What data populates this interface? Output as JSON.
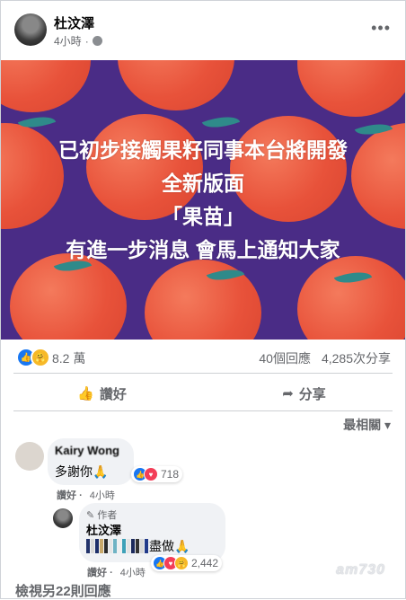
{
  "post": {
    "author": "杜汶澤",
    "time": "4小時",
    "more_icon": "more-icon",
    "privacy_icon": "globe-icon"
  },
  "image": {
    "lines": [
      "已初步接觸果籽同事本台將開發",
      "全新版面",
      "「果苗」",
      "有進一步消息 會馬上通知大家"
    ],
    "colors": {
      "background": "#4a2c86",
      "fruit": "#e8523a",
      "leaf": "#2f8a8a"
    }
  },
  "stats": {
    "reaction_count": "8.2 萬",
    "comments": "40個回應",
    "shares": "4,285次分享"
  },
  "actions": {
    "like": "讚好",
    "share": "分享"
  },
  "sort_label": "最相關",
  "comments": [
    {
      "author": "Kairy Wong",
      "text": "多謝你🙏",
      "reaction_count": "718",
      "like": "讚好",
      "time": "4小時"
    },
    {
      "author_badge": "作者",
      "author": "杜汶澤",
      "text_suffix": "盡做🙏",
      "reaction_count": "2,442",
      "like": "讚好",
      "time": "4小時"
    }
  ],
  "view_more": "檢視另22則回應",
  "watermark": "am730",
  "colors": {
    "accent": "#1877f2",
    "secondary_text": "#65676b",
    "bubble": "#f0f2f5"
  }
}
